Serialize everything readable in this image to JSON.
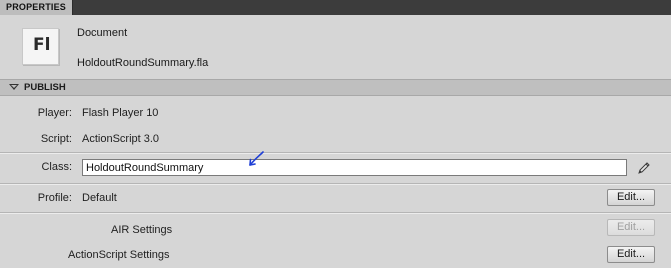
{
  "panel": {
    "tab_label": "PROPERTIES"
  },
  "document": {
    "icon_text": "Fl",
    "type": "Document",
    "filename": "HoldoutRoundSummary.fla"
  },
  "publish": {
    "section_title": "PUBLISH",
    "player_label": "Player:",
    "player_value": "Flash Player 10",
    "script_label": "Script:",
    "script_value": "ActionScript 3.0",
    "class_label": "Class:",
    "class_value": "HoldoutRoundSummary",
    "profile_label": "Profile:",
    "profile_value": "Default",
    "profile_edit": "Edit...",
    "air_settings_label": "AIR Settings",
    "air_settings_edit": "Edit...",
    "as_settings_label": "ActionScript Settings",
    "as_settings_edit": "Edit..."
  },
  "colors": {
    "annotation_arrow": "#1f3fd6"
  }
}
